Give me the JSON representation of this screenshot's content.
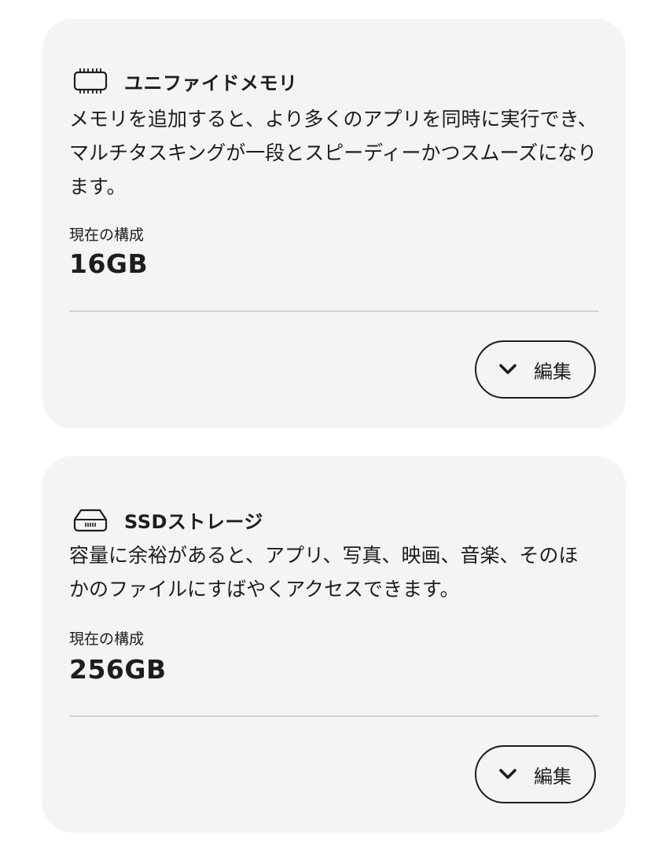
{
  "memory": {
    "icon": "memory-chip-icon",
    "title": "ユニファイドメモリ",
    "description": "メモリを追加すると、より多くのアプリを同時に実行でき、マルチタスキングが一段とスピーディーかつスムーズになります。",
    "config_label": "現在の構成",
    "config_value": "16GB",
    "edit_label": "編集"
  },
  "storage": {
    "icon": "ssd-drive-icon",
    "title": "SSDストレージ",
    "description": "容量に余裕があると、アプリ、写真、映画、音楽、そのほかのファイルにすばやくアクセスできます。",
    "config_label": "現在の構成",
    "config_value": "256GB",
    "edit_label": "編集"
  },
  "colors": {
    "card_background": "#f4f4f6",
    "text": "#1d1d1f",
    "divider": "#d2d2d7"
  }
}
